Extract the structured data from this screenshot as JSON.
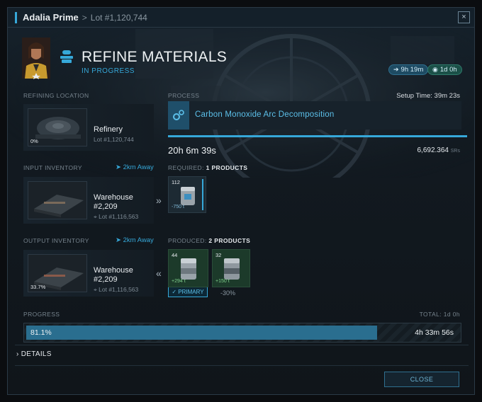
{
  "window": {
    "title": "Adalia Prime",
    "separator": ">",
    "subtitle": "Lot #1,120,744",
    "close_glyph": "×"
  },
  "header": {
    "title": "REFINE MATERIALS",
    "status": "IN PROGRESS",
    "badge_1": "9h 19m",
    "badge_2": "1d 0h"
  },
  "refining_location": {
    "label": "REFINING LOCATION",
    "name": "Refinery",
    "lot": "Lot #1,120,744",
    "thumb_pct": "0%"
  },
  "process": {
    "label": "PROCESS",
    "setup_time": "Setup Time: 39m 23s",
    "name": "Carbon Monoxide Arc Decomposition",
    "timer": "20h 6m 39s",
    "sr_value": "6,692.364",
    "sr_unit": "SRs"
  },
  "input_inventory": {
    "label": "INPUT INVENTORY",
    "away": "2km Away",
    "name_line1": "Warehouse",
    "name_line2": "#2,209",
    "lot": "Lot #1,116,563"
  },
  "required": {
    "label_prefix": "REQUIRED:",
    "label_value": "1 PRODUCTS",
    "items": [
      {
        "count": "112",
        "amount": "-750 t"
      }
    ]
  },
  "output_inventory": {
    "label": "OUTPUT INVENTORY",
    "away": "2km Away",
    "name_line1": "Warehouse",
    "name_line2": "#2,209",
    "lot": "Lot #1,116,563",
    "thumb_pct": "33.7%"
  },
  "produced": {
    "label_prefix": "PRODUCED:",
    "label_value": "2 PRODUCTS",
    "primary_label": "✓ PRIMARY",
    "secondary_pct": "-30%",
    "items": [
      {
        "count": "44",
        "amount": "+294 t"
      },
      {
        "count": "32",
        "amount": "+150 t"
      }
    ]
  },
  "progress": {
    "label": "PROGRESS",
    "total": "TOTAL: 1d 0h",
    "percent_text": "81.1%",
    "fraction": 0.811,
    "remaining": "4h 33m 56s"
  },
  "details": {
    "label": "DETAILS"
  },
  "footer": {
    "close_label": "CLOSE"
  },
  "colors": {
    "accent": "#36a8d9",
    "panel": "#17222b",
    "green_tile": "#1c3a2a"
  }
}
